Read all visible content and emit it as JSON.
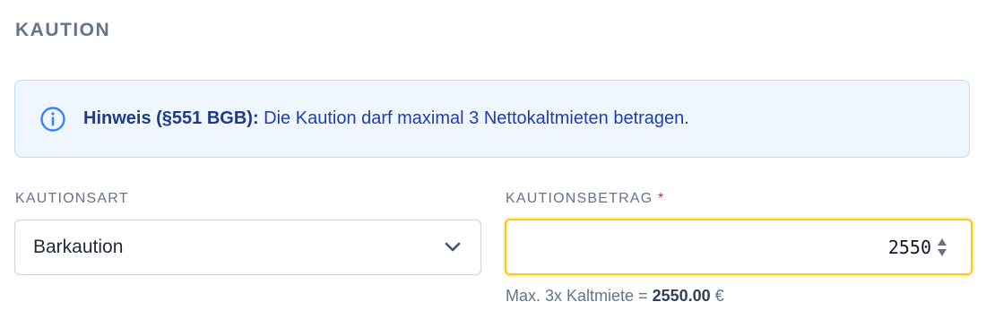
{
  "section": {
    "title": "KAUTION"
  },
  "notice": {
    "icon": "info-icon",
    "bold": "Hinweis (§551 BGB):",
    "text": " Die Kaution darf maximal 3 Nettokaltmieten betragen."
  },
  "deposit_type": {
    "label": "KAUTIONSART",
    "value": "Barkaution",
    "icon": "chevron-down-icon"
  },
  "deposit_amount": {
    "label": "KAUTIONSBETRAG",
    "required_marker": "*",
    "value": "2550",
    "spinner_icon": "stepper-arrows-icon",
    "helper_prefix": "Max. 3x Kaltmiete = ",
    "helper_amount": "2550.00",
    "helper_suffix": " €"
  },
  "colors": {
    "accent": "#1e40af",
    "notice_bg": "#eff6ff",
    "focus_border": "#facc15",
    "required": "#dc2626"
  }
}
